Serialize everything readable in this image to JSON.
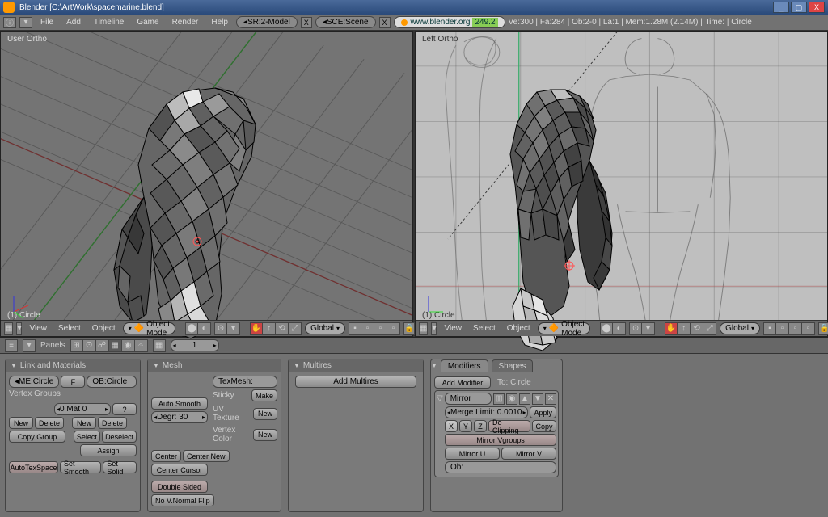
{
  "window": {
    "title": "Blender [C:\\ArtWork\\spacemarine.blend]"
  },
  "win_controls": {
    "min": "_",
    "max": "▢",
    "close": "X"
  },
  "top_menu": [
    "File",
    "Add",
    "Timeline",
    "Game",
    "Render",
    "Help"
  ],
  "screen_selector": "SR:2-Model",
  "scene_selector": "SCE:Scene",
  "web": {
    "label": "www.blender.org",
    "version": "249.2"
  },
  "stats_line": "Ve:300 | Fa:284 | Ob:2-0 | La:1 | Mem:1.28M (2.14M) | Time: | Circle",
  "viewport_left": {
    "label": "User Ortho",
    "object_label": "(1) Circle"
  },
  "viewport_right": {
    "label": "Left Ortho",
    "object_label": "(1) Circle"
  },
  "vh_menu": [
    "View",
    "Select",
    "Object"
  ],
  "mode": "Object Mode",
  "orient": "Global",
  "panels_label": "Panels",
  "pager": "1",
  "panel_link": {
    "title": "Link and Materials",
    "me": "ME:Circle",
    "f": "F",
    "ob": "OB:Circle",
    "vg": "Vertex Groups",
    "mat": "0 Mat 0",
    "q": "?",
    "new": "New",
    "delete": "Delete",
    "select": "Select",
    "deselect": "Deselect",
    "copy": "Copy Group",
    "assign": "Assign",
    "autotex": "AutoTexSpace",
    "smooth": "Set Smooth",
    "solid": "Set Solid"
  },
  "panel_mesh": {
    "title": "Mesh",
    "auto": "Auto Smooth",
    "degr": "Degr: 30",
    "texmesh": "TexMesh:",
    "sticky": "Sticky",
    "make": "Make",
    "uv": "UV Texture",
    "new": "New",
    "vcol": "Vertex Color",
    "center": "Center",
    "cnew": "Center New",
    "ccursor": "Center Cursor",
    "double": "Double Sided",
    "novnorm": "No V.Normal Flip"
  },
  "panel_multires": {
    "title": "Multires",
    "add": "Add Multires"
  },
  "panel_mod": {
    "tab1": "Modifiers",
    "tab2": "Shapes",
    "add": "Add Modifier",
    "to": "To: Circle",
    "mirror": "Mirror",
    "merge": "Merge Limit: 0.0010",
    "apply": "Apply",
    "copy": "Copy",
    "x": "X",
    "y": "Y",
    "z": "Z",
    "clip": "Do Clipping",
    "mvg": "Mirror Vgroups",
    "mu": "Mirror U",
    "mv": "Mirror V",
    "ob": "Ob:"
  }
}
